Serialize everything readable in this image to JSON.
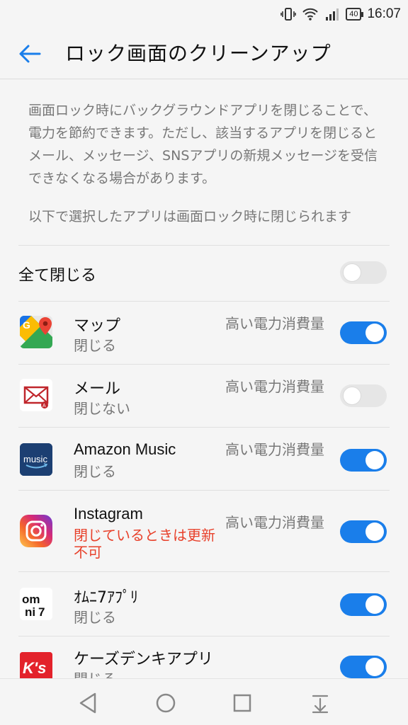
{
  "status_bar": {
    "time": "16:07",
    "battery": "40"
  },
  "header": {
    "title": "ロック画面のクリーンアップ"
  },
  "description": "画面ロック時にバックグラウンドアプリを閉じることで、電力を節約できます。ただし、該当するアプリを閉じるとメール、メッセージ、SNSアプリの新規メッセージを受信できなくなる場合があります。",
  "note": "以下で選択したアプリは画面ロック時に閉じられます",
  "close_all": {
    "label": "全て閉じる",
    "enabled": false
  },
  "apps": [
    {
      "name": "マップ",
      "status": "閉じる",
      "power": "高い電力消費量",
      "enabled": true,
      "icon": "google-maps-icon"
    },
    {
      "name": "メール",
      "status": "閉じない",
      "power": "高い電力消費量",
      "enabled": false,
      "icon": "mail-icon"
    },
    {
      "name": "Amazon Music",
      "status": "閉じる",
      "power": "高い電力消費量",
      "enabled": true,
      "icon": "amazon-music-icon",
      "icon_text": "music"
    },
    {
      "name": "Instagram",
      "status": "閉じているときは更新不可",
      "power": "高い電力消費量",
      "enabled": true,
      "icon": "instagram-icon"
    },
    {
      "name": "ｵﾑﾆ7ｱﾌﾟﾘ",
      "status": "閉じる",
      "power": "",
      "enabled": true,
      "icon": "omni7-icon",
      "icon_text": "omni7"
    },
    {
      "name": "ケーズデンキアプリ",
      "status": "閉じる",
      "power": "",
      "enabled": true,
      "icon": "ksdenki-icon",
      "icon_text": "K's"
    }
  ],
  "colors": {
    "accent": "#1a7eea",
    "warning": "#e8412b",
    "toggle_off": "#e6e6e6"
  },
  "nav": [
    "back-icon",
    "home-icon",
    "recents-icon",
    "notification-pull-icon"
  ]
}
